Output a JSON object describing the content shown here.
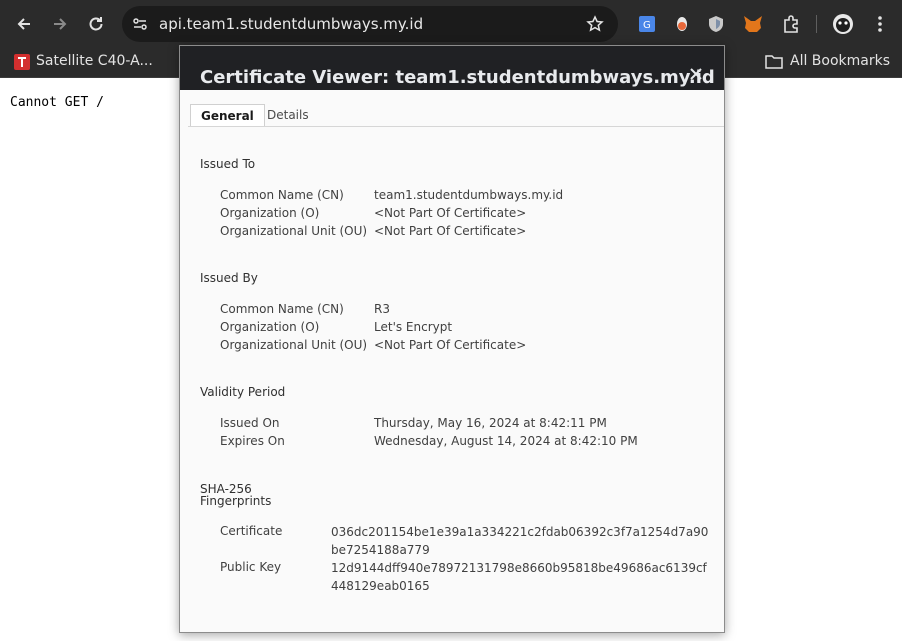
{
  "browser": {
    "url": "api.team1.studentdumbways.my.id",
    "bookmarks": {
      "item1": "Satellite C40-A...",
      "all": "All Bookmarks"
    }
  },
  "page": {
    "body_text": "Cannot GET /"
  },
  "dialog": {
    "title": "Certificate Viewer: team1.studentdumbways.my.id",
    "tabs": [
      "General",
      "Details"
    ],
    "issued_to": {
      "title": "Issued To",
      "rows": [
        {
          "label": "Common Name (CN)",
          "value": "team1.studentdumbways.my.id"
        },
        {
          "label": "Organization (O)",
          "value": "<Not Part Of Certificate>"
        },
        {
          "label": "Organizational Unit (OU)",
          "value": "<Not Part Of Certificate>"
        }
      ]
    },
    "issued_by": {
      "title": "Issued By",
      "rows": [
        {
          "label": "Common Name (CN)",
          "value": "R3"
        },
        {
          "label": "Organization (O)",
          "value": "Let's Encrypt"
        },
        {
          "label": "Organizational Unit (OU)",
          "value": "<Not Part Of Certificate>"
        }
      ]
    },
    "validity": {
      "title": "Validity Period",
      "rows": [
        {
          "label": "Issued On",
          "value": "Thursday, May 16, 2024 at 8:42:11 PM"
        },
        {
          "label": "Expires On",
          "value": "Wednesday, August 14, 2024 at 8:42:10 PM"
        }
      ]
    },
    "fingerprints": {
      "title_line1": "SHA-256",
      "title_line2": "Fingerprints",
      "rows": [
        {
          "label": "Certificate",
          "value": "036dc201154be1e39a1a334221c2fdab06392c3f7a1254d7a90be7254188a779"
        },
        {
          "label": "Public Key",
          "value": "12d9144dff940e78972131798e8660b95818be49686ac6139cf448129eab0165"
        }
      ]
    }
  }
}
